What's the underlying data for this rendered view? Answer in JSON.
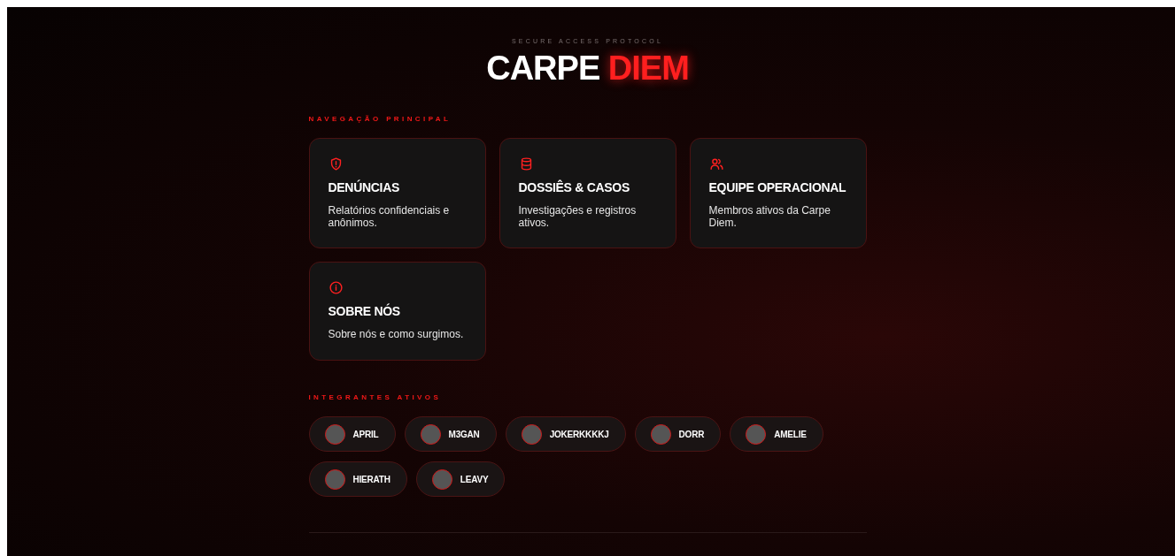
{
  "header": {
    "eyebrow": "SECURE ACCESS PROTOCOL",
    "title_main": "CARPE",
    "title_accent": "DIEM"
  },
  "navigation": {
    "heading": "NAVEGAÇÃO PRINCIPAL",
    "cards": [
      {
        "kind": "shield",
        "title": "DENÚNCIAS",
        "description": "Relatórios confidenciais e anônimos."
      },
      {
        "kind": "database",
        "title": "DOSSIÊS & CASOS",
        "description": "Investigações e registros ativos."
      },
      {
        "kind": "users",
        "title": "EQUIPE OPERACIONAL",
        "description": "Membros ativos da Carpe Diem."
      },
      {
        "kind": "info",
        "title": "SOBRE NÓS",
        "description": "Sobre nós e como surgimos."
      }
    ]
  },
  "members": {
    "heading": "INTEGRANTES ATIVOS",
    "items": [
      {
        "name": "APRIL"
      },
      {
        "name": "M3GAN"
      },
      {
        "name": "JOKERKKKKJ"
      },
      {
        "name": "DORR"
      },
      {
        "name": "AMELIE"
      },
      {
        "name": "HIERATH"
      },
      {
        "name": "LEAVY"
      }
    ]
  }
}
